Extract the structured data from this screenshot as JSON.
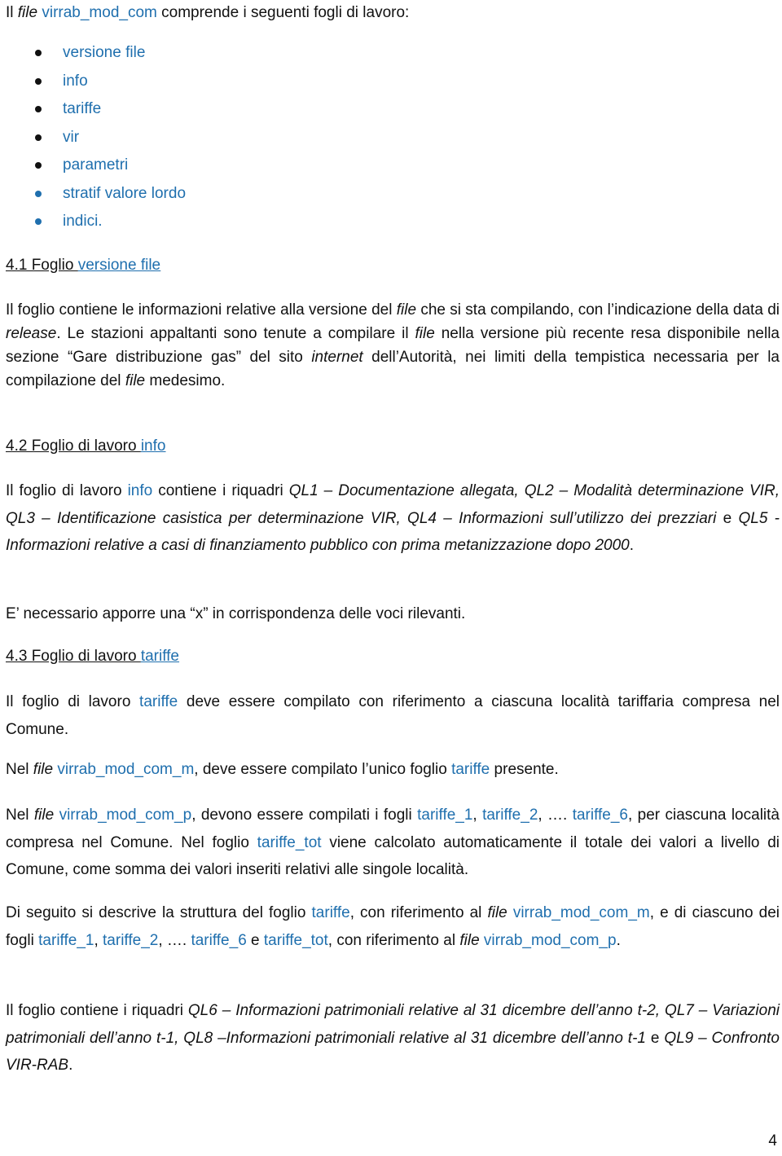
{
  "intro": {
    "prefix": "Il ",
    "file_word": "file",
    "file_name": "virrab_mod_com",
    "suffix": " comprende i seguenti fogli di lavoro:"
  },
  "sheets": [
    {
      "label": "versione file",
      "bullet_color": "#111111"
    },
    {
      "label": "info",
      "bullet_color": "#111111"
    },
    {
      "label": "tariffe",
      "bullet_color": "#111111"
    },
    {
      "label": "vir",
      "bullet_color": "#111111"
    },
    {
      "label": "parametri",
      "bullet_color": "#111111"
    },
    {
      "label": "stratif valore lordo",
      "bullet_color": "#1f6fae"
    },
    {
      "label": "indici.",
      "bullet_color": "#1f6fae"
    }
  ],
  "section_4_1": {
    "heading_prefix": "4.1 Foglio ",
    "heading_link": "versione file",
    "p1": {
      "t1": "Il foglio contiene le informazioni relative alla versione del ",
      "i1": "file",
      "t2": " che si sta compilando, con l’indicazione della data di ",
      "i2": "release",
      "t3": ". Le stazioni appaltanti sono tenute a compilare il ",
      "i3": "file",
      "t4": " nella versione più recente resa disponibile nella sezione “Gare distribuzione gas” del sito ",
      "i4": "internet",
      "t5": " dell’Autorità, nei limiti della tempistica necessaria per la compilazione del ",
      "i5": "file",
      "t6": " medesimo."
    }
  },
  "section_4_2": {
    "heading_prefix": "4.2 Foglio di lavoro ",
    "heading_link": "info",
    "p1": {
      "t1": "Il foglio di lavoro ",
      "link": "info",
      "t2": " contiene i riquadri ",
      "i1": "QL1 – Documentazione allegata, QL2 – Modalità determinazione VIR, QL3 – Identificazione casistica per determinazione VIR, QL4 – Informazioni sull’utilizzo dei prezziari",
      "t3": " e ",
      "i2": "QL5 - Informazioni relative a casi di finanziamento pubblico con prima metanizzazione dopo 2000",
      "t4": "."
    },
    "p2": "E’ necessario apporre una “x” in corrispondenza delle voci rilevanti."
  },
  "section_4_3": {
    "heading_prefix": "4.3 Foglio di lavoro ",
    "heading_link": "tariffe",
    "p1": {
      "t1": "Il foglio di lavoro ",
      "link": "tariffe",
      "t2": " deve essere compilato con riferimento a ciascuna località tariffaria compresa nel Comune."
    },
    "p2": {
      "t1": "Nel ",
      "i1": "file",
      "t2": " ",
      "l1": "virrab_mod_com_m",
      "t3": ", deve essere compilato l’unico foglio ",
      "l2": "tariffe",
      "t4": " presente."
    },
    "p3": {
      "t1": "Nel ",
      "i1": "file",
      "t2": " ",
      "l1": "virrab_mod_com_p",
      "t3": ", devono essere compilati i fogli ",
      "l2": "tariffe_1",
      "t4": ", ",
      "l3": "tariffe_2",
      "t5": ", …. ",
      "l4": "tariffe_6",
      "t6": ", per ciascuna località compresa nel Comune. Nel foglio ",
      "l5": "tariffe_tot",
      "t7": " viene calcolato automaticamente il totale dei valori a livello di Comune, come somma dei valori inseriti relativi alle singole località."
    },
    "p4": {
      "t1": "Di seguito si descrive la struttura del foglio ",
      "l1": "tariffe",
      "t2": ", con riferimento al ",
      "i1": "file",
      "t3": " ",
      "l2": "virrab_mod_com_m",
      "t4": ", e di ciascuno dei fogli ",
      "l3": "tariffe_1",
      "t5": ", ",
      "l4": "tariffe_2",
      "t6": ", …. ",
      "l5": "tariffe_6",
      "t7": " e ",
      "l6": "tariffe_tot",
      "t8": ", con riferimento al ",
      "i2": "file",
      "t9": " ",
      "l7": "virrab_mod_com_p",
      "t10": "."
    },
    "p5": {
      "t1": "Il foglio contiene i riquadri ",
      "i1": "QL6 – Informazioni patrimoniali relative al 31 dicembre dell’anno t-2, QL7 – Variazioni patrimoniali dell’anno t-1, QL8 –Informazioni patrimoniali relative al 31 dicembre dell’anno t-1",
      "t2": " e ",
      "i2": "QL9 – Confronto VIR-RAB",
      "t3": "."
    }
  },
  "page_number": "4",
  "colors": {
    "link": "#1f6fae",
    "text": "#111111"
  }
}
